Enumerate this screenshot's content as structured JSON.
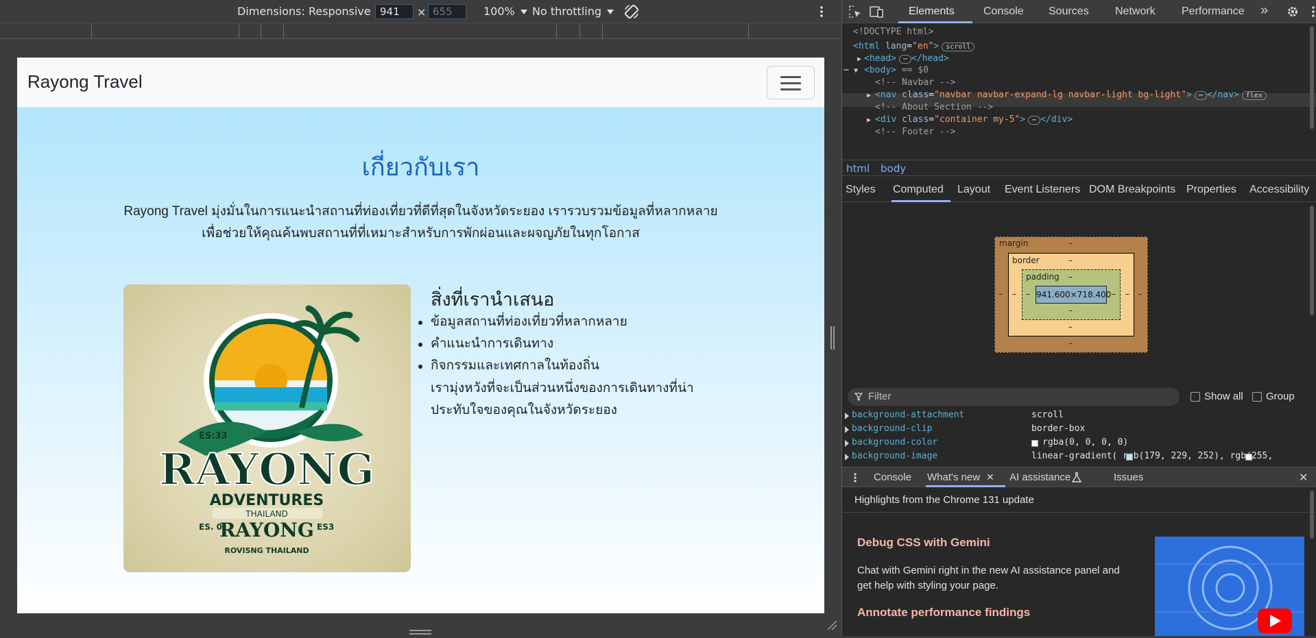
{
  "device_toolbar": {
    "dimensions_label": "Dimensions: Responsive",
    "width": "941",
    "times": "×",
    "height_placeholder": "655",
    "zoom": "100%",
    "throttling": "No throttling",
    "rotate_icon": "rotate-icon",
    "more_icon": "more-vert-icon"
  },
  "page": {
    "brand": "Rayong Travel",
    "toggler_icon": "hamburger-icon",
    "about_title": "เกี่ยวกับเรา",
    "lead_line1": "Rayong Travel มุ่งมั่นในการแนะนำสถานที่ท่องเที่ยวที่ดีที่สุดในจังหวัดระยอง เรารวบรวมข้อมูลที่หลากหลาย",
    "lead_line2": "เพื่อช่วยให้คุณค้นพบสถานที่ที่เหมาะสำหรับการพักผ่อนและผจญภัยในทุกโอกาส",
    "logo": {
      "es_small": "ES:33",
      "word_main": "RAYONG",
      "word_sub": "ADVENTURES",
      "ribbon": "THAILAND",
      "small_left": "ES. 0",
      "small_right": "ES3",
      "small_word": "RAYONG",
      "bottom": "ROVISNG THAILAND"
    },
    "offer_title": "สิ่งที่เรานำเสนอ",
    "offers": [
      "ข้อมูลสถานที่ท่องเที่ยวที่หลากหลาย",
      "คำแนะนำการเดินทาง",
      "กิจกรรมและเทศกาลในท้องถิ่น"
    ],
    "closing_line1": "เรามุ่งหวังที่จะเป็นส่วนหนึ่งของการเดินทางที่น่า",
    "closing_line2": "ประทับใจของคุณในจังหวัดระยอง"
  },
  "devtools": {
    "tabs": [
      "Elements",
      "Console",
      "Sources",
      "Network",
      "Performance"
    ],
    "more_tabs": "»",
    "dom": {
      "doctype": "<!DOCTYPE html>",
      "html_open": "<html",
      "html_attr": "lang",
      "html_val": "\"en\"",
      "scroll_pill": "scroll",
      "head": "<head>",
      "head_close": "</head>",
      "body": "<body>",
      "body_eq": "== $0",
      "c_navbar": "<!-- Navbar -->",
      "nav_open": "<nav",
      "nav_attr": "class",
      "nav_val": "\"navbar navbar-expand-lg navbar-light bg-light\"",
      "nav_close": "</nav>",
      "flex_pill": "flex",
      "c_about": "<!-- About Section -->",
      "div_open": "<div",
      "div_attr": "class",
      "div_val": "\"container my-5\"",
      "div_close": "</div>",
      "c_footer": "<!-- Footer -->"
    },
    "breadcrumbs": [
      "html",
      "body"
    ],
    "subtabs": [
      "Styles",
      "Computed",
      "Layout",
      "Event Listeners",
      "DOM Breakpoints",
      "Properties",
      "Accessibility"
    ],
    "box_model": {
      "margin_label": "margin",
      "border_label": "border",
      "padding_label": "padding",
      "content_size": "941.600×718.400",
      "dash": "–"
    },
    "filter_placeholder": "Filter",
    "show_all": "Show all",
    "group": "Group",
    "properties": [
      {
        "name": "background-attachment",
        "value": "scroll"
      },
      {
        "name": "background-clip",
        "value": "border-box"
      },
      {
        "name": "background-color",
        "value": "rgba(0, 0, 0, 0)"
      },
      {
        "name": "background-image",
        "value": "linear-gradient(   rgb(179, 229, 252),    rgb(255,"
      }
    ],
    "drawer_tabs": [
      "Console",
      "What's new",
      "AI assistance",
      "Issues"
    ],
    "whats_new": {
      "header": "Highlights from the Chrome 131 update",
      "title1": "Debug CSS with Gemini",
      "text1_line1": "Chat with Gemini right in the new AI assistance panel and",
      "text1_line2": "get help with styling your page.",
      "title2": "Annotate performance findings"
    }
  },
  "colors": {
    "devtools_bg": "#282828",
    "toolbar_bg": "#3c3c3c",
    "accent_blue": "#8ab4f8",
    "title_blue": "#1565c0",
    "gradient_top": "rgb(179, 229, 252)",
    "gradient_bottom": "rgb(255, 255, 255)"
  }
}
